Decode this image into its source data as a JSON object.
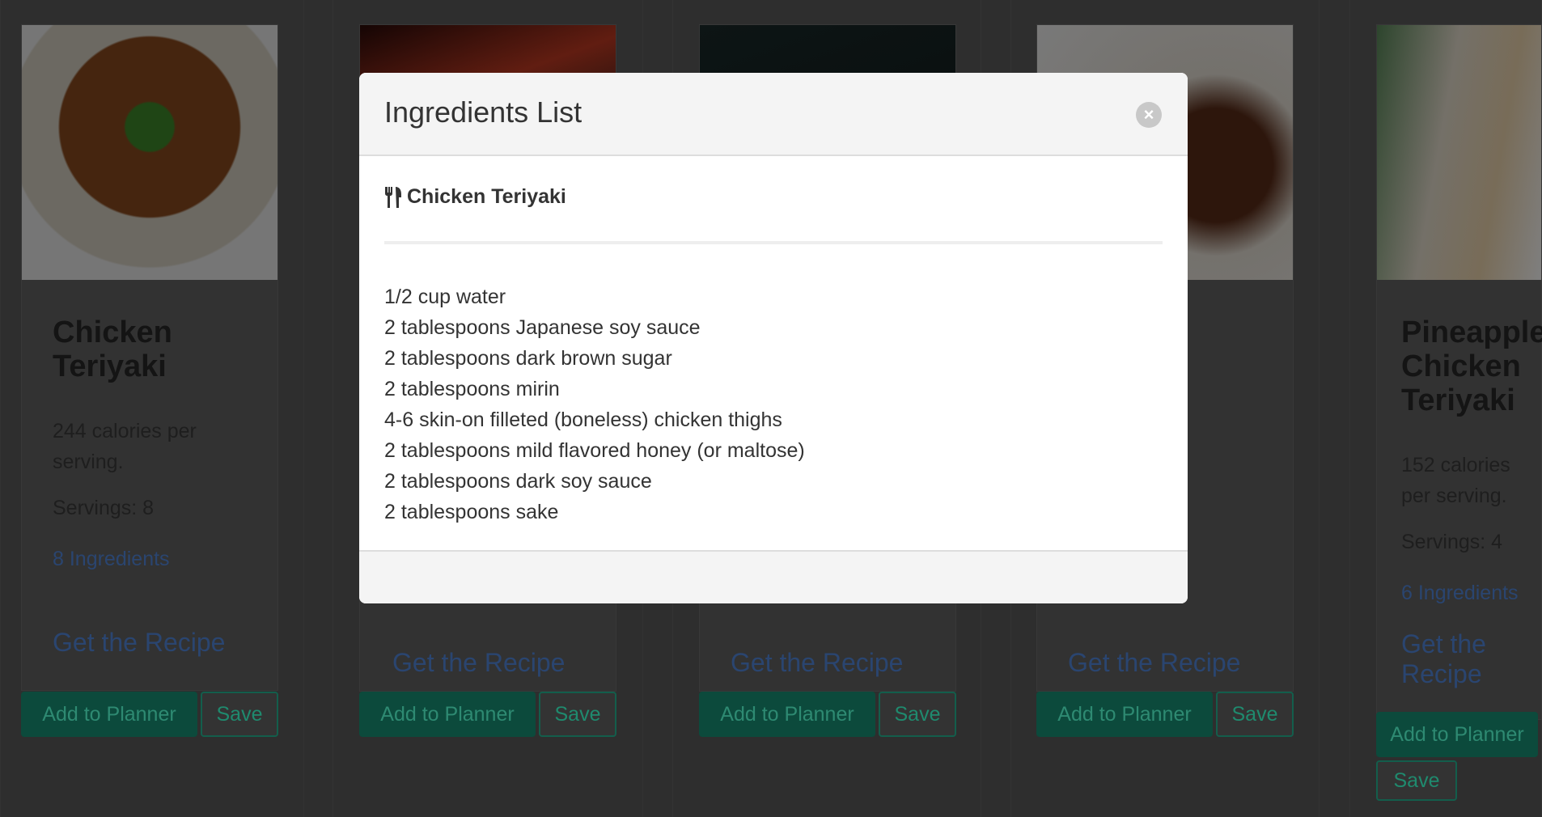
{
  "cards": [
    {
      "title": "Chicken Teriyaki",
      "calories": "244 calories per serving.",
      "servings": "Servings: 8",
      "ingredients_link": "8 Ingredients",
      "recipe_link": "Get the Recipe",
      "add_label": "Add to Planner",
      "save_label": "Save"
    },
    {
      "recipe_link": "Get the Recipe",
      "add_label": "Add to Planner",
      "save_label": "Save"
    },
    {
      "recipe_link": "Get the Recipe",
      "add_label": "Add to Planner",
      "save_label": "Save"
    },
    {
      "recipe_link": "Get the Recipe",
      "add_label": "Add to Planner",
      "save_label": "Save"
    },
    {
      "title": "Pineapple Chicken Teriyaki",
      "calories": "152 calories per serving.",
      "servings": "Servings: 4",
      "ingredients_link": "6 Ingredients",
      "recipe_link": "Get the Recipe",
      "add_label": "Add to Planner",
      "save_label": "Save"
    }
  ],
  "modal": {
    "title": "Ingredients List",
    "close_icon": "close-circle-icon",
    "recipe_icon": "utensils-icon",
    "recipe_name": "Chicken Teriyaki",
    "ingredients": [
      "1/2 cup water",
      "2 tablespoons Japanese soy sauce",
      "2 tablespoons dark brown sugar",
      "2 tablespoons mirin",
      "4-6 skin-on filleted (boneless) chicken thighs",
      "2 tablespoons mild flavored honey (or maltose)",
      "2 tablespoons dark soy sauce",
      "2 tablespoons sake"
    ]
  },
  "colors": {
    "accent": "#17a383",
    "link": "#3b6db3"
  }
}
